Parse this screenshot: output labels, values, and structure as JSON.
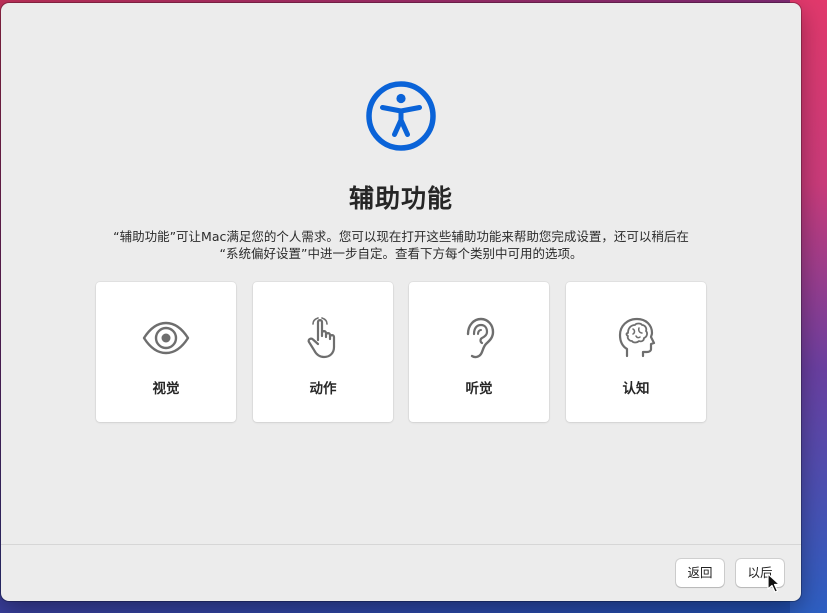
{
  "window": {
    "title": "辅助功能",
    "description_line1": "“辅助功能”可让Mac满足您的个人需求。您可以现在打开这些辅助功能来帮助您完成设置，还可以稍后在",
    "description_line2": "“系统偏好设置”中进一步自定。查看下方每个类别中可用的选项。",
    "hero_icon": "accessibility-icon",
    "accent_color": "#0a63d8"
  },
  "categories": [
    {
      "label": "视觉",
      "icon": "eye-icon"
    },
    {
      "label": "动作",
      "icon": "hand-pointer-icon"
    },
    {
      "label": "听觉",
      "icon": "ear-icon"
    },
    {
      "label": "认知",
      "icon": "brain-head-icon"
    }
  ],
  "footer": {
    "back_label": "返回",
    "later_label": "以后"
  }
}
